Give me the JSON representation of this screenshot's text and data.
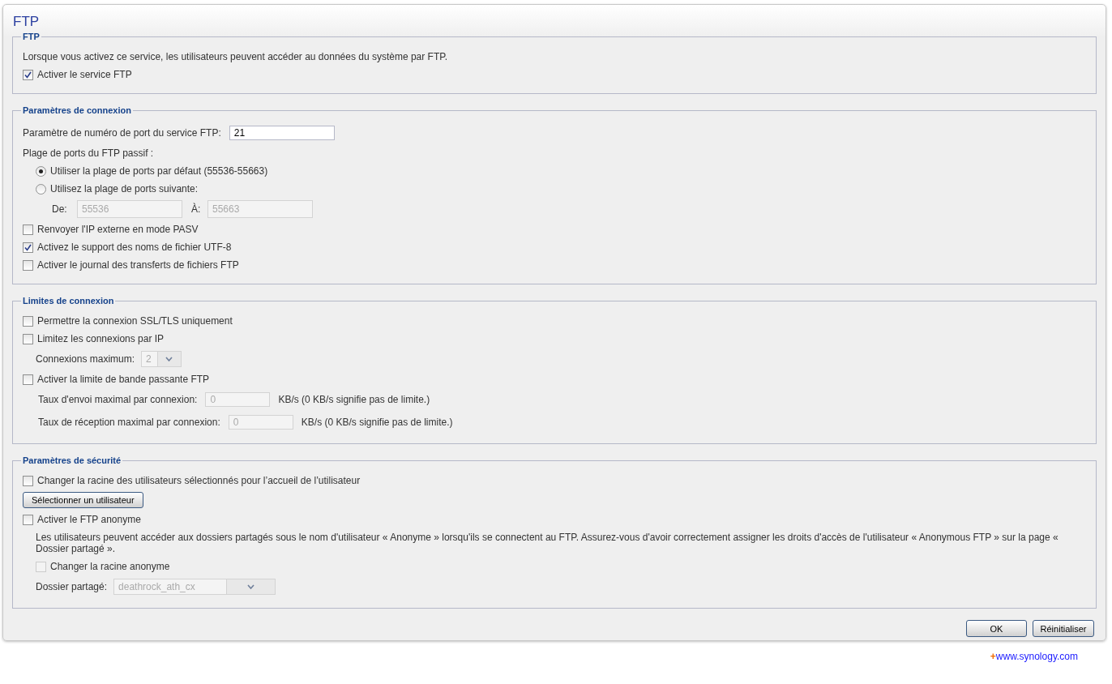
{
  "page": {
    "title": "FTP"
  },
  "sections": [
    {
      "legend": "FTP",
      "rows": [
        {
          "kind": "text",
          "text": "Lorsque vous activez ce service, les utilisateurs peuvent accéder au données du système par FTP."
        },
        {
          "kind": "checkbox",
          "label": "Activer le service FTP",
          "checked": true,
          "disabled": false
        }
      ]
    },
    {
      "legend": "Paramètres de connexion",
      "rows": [
        {
          "kind": "field",
          "label": "Paramètre de numéro de port du service FTP:",
          "value": "21",
          "disabled": false
        },
        {
          "kind": "text",
          "text": "Plage de ports du FTP passif :",
          "children": [
            {
              "kind": "radio",
              "label": "Utiliser la plage de ports par défaut (55536-55663)",
              "selected": true
            },
            {
              "kind": "radio",
              "label": "Utilisez la plage de ports suivante:",
              "selected": false,
              "children": [
                {
                  "kind": "range",
                  "from_label": "De:",
                  "from_value": "55536",
                  "to_label": "À:",
                  "to_value": "55663",
                  "disabled": true
                }
              ]
            }
          ]
        },
        {
          "kind": "checkbox",
          "label": "Renvoyer l'IP externe en mode PASV",
          "checked": false,
          "disabled": false
        },
        {
          "kind": "checkbox",
          "label": "Activez le support des noms de fichier UTF-8",
          "checked": true,
          "disabled": false
        },
        {
          "kind": "checkbox",
          "label": "Activer le journal des transferts de fichiers FTP",
          "checked": false,
          "disabled": false
        }
      ]
    },
    {
      "legend": "Limites de connexion",
      "rows": [
        {
          "kind": "checkbox",
          "label": "Permettre la connexion SSL/TLS uniquement",
          "checked": false,
          "disabled": false
        },
        {
          "kind": "checkbox",
          "label": "Limitez les connexions par IP",
          "checked": false,
          "disabled": false,
          "children": [
            {
              "kind": "select",
              "label": "Connexions maximum:",
              "value": "2",
              "disabled": true
            }
          ]
        },
        {
          "kind": "checkbox",
          "label": "Activer la limite de bande passante FTP",
          "checked": false,
          "disabled": false,
          "children": [
            {
              "kind": "field",
              "label": "Taux d'envoi maximal par connexion:",
              "value": "0",
              "suffix": "KB/s (0 KB/s signifie pas de limite.)",
              "disabled": true
            },
            {
              "kind": "field",
              "label": "Taux de réception maximal par connexion:",
              "value": "0",
              "suffix": "KB/s (0 KB/s signifie pas de limite.)",
              "disabled": true
            }
          ]
        }
      ]
    },
    {
      "legend": "Paramètres de sécurité",
      "rows": [
        {
          "kind": "checkbox",
          "label": "Changer la racine des utilisateurs sélectionnés pour l’accueil de l’utilisateur",
          "checked": false,
          "disabled": false
        },
        {
          "kind": "button",
          "label": "Sélectionner un utilisateur"
        },
        {
          "kind": "checkbox",
          "label": "Activer le FTP anonyme",
          "checked": false,
          "disabled": false,
          "children": [
            {
              "kind": "text",
              "text": "Les utilisateurs peuvent accéder aux dossiers partagés sous le nom d'utilisateur « Anonyme » lorsqu'ils se connectent au FTP. Assurez-vous d'avoir correctement assigner les droits d'accès de l'utilisateur « Anonymous FTP » sur la page « Dossier partagé »."
            },
            {
              "kind": "checkbox",
              "label": "Changer la racine anonyme",
              "checked": false,
              "disabled": true
            },
            {
              "kind": "select",
              "label": "Dossier partagé:",
              "value": "deathrock_ath_cx",
              "disabled": true
            }
          ]
        }
      ]
    }
  ],
  "buttons": [
    {
      "label": "OK"
    },
    {
      "label": "Réinitialiser"
    }
  ],
  "footer": {
    "mark": "+",
    "link": "www.synology.com"
  }
}
